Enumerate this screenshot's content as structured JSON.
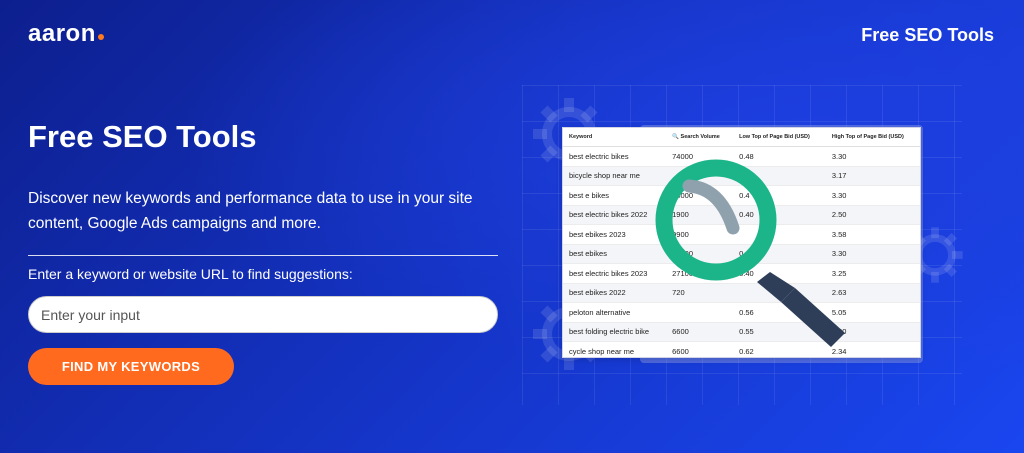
{
  "header": {
    "logo_text": "aaron",
    "right_title": "Free SEO Tools"
  },
  "hero": {
    "heading": "Free SEO Tools",
    "description": "Discover new keywords and performance data to use in your site content, Google Ads campaigns and more.",
    "prompt": "Enter a keyword or website URL to find suggestions:",
    "input_value": "",
    "input_placeholder": "Enter your input",
    "button_label": "FIND MY KEYWORDS"
  },
  "table": {
    "columns": [
      "Keyword",
      "Search Volume",
      "Low Top of Page Bid (USD)",
      "High Top of Page Bid (USD)"
    ],
    "rows": [
      [
        "best electric bikes",
        "74000",
        "0.48",
        "3.30"
      ],
      [
        "bicycle shop near me",
        "",
        "",
        "3.17"
      ],
      [
        "best e bikes",
        "74000",
        "0.4",
        "3.30"
      ],
      [
        "best electric bikes 2022",
        "1900",
        "0.40",
        "2.50"
      ],
      [
        "best ebikes 2023",
        "9900",
        "",
        "3.58"
      ],
      [
        "best ebikes",
        "74000",
        "0.48",
        "3.30"
      ],
      [
        "best electric bikes 2023",
        "27100",
        "0.40",
        "3.25"
      ],
      [
        "best ebikes 2022",
        "720",
        "",
        "2.63"
      ],
      [
        "peloton alternative",
        "",
        "0.56",
        "5.05"
      ],
      [
        "best folding electric bike",
        "6600",
        "0.55",
        "4.00"
      ],
      [
        "cycle shop near me",
        "6600",
        "0.62",
        "2.34"
      ]
    ]
  },
  "colors": {
    "accent": "#ff6a1f",
    "background": "#1535c8",
    "magnifier_ring": "#1cb58a",
    "magnifier_handle": "#2e3e58"
  },
  "icons": {
    "magnifier": "magnifying-glass-icon",
    "gear": "gear-icon",
    "volume_icon": "search-volume-icon"
  }
}
